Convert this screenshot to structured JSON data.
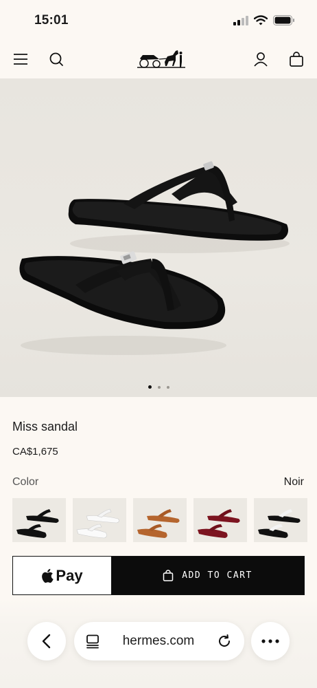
{
  "status": {
    "time": "15:01",
    "icons": [
      "cellular-signal-icon",
      "wifi-icon",
      "battery-icon"
    ]
  },
  "nav": {
    "menu_icon": "hamburger-menu-icon",
    "search_icon": "search-icon",
    "logo": "hermes-carriage-logo",
    "account_icon": "account-icon",
    "bag_icon": "shopping-bag-icon"
  },
  "gallery": {
    "image": "black-sandals-photo",
    "current_index": 1,
    "total": 3
  },
  "product": {
    "name": "Miss sandal",
    "price": "CA$1,675"
  },
  "color": {
    "label": "Color",
    "value": "Noir",
    "options": [
      "black",
      "white",
      "tan",
      "burgundy",
      "black-white"
    ]
  },
  "actions": {
    "apple_pay_label": "Pay",
    "add_to_cart_label": "ADD TO CART"
  },
  "browser": {
    "url": "hermes.com",
    "back_icon": "chevron-left-icon",
    "tabs_icon": "page-icon",
    "reload_icon": "reload-icon",
    "more_icon": "more-icon"
  },
  "colors": {
    "background": "#fcf8f3",
    "button_black": "#0c0c0c",
    "text": "#1c1c1c"
  }
}
